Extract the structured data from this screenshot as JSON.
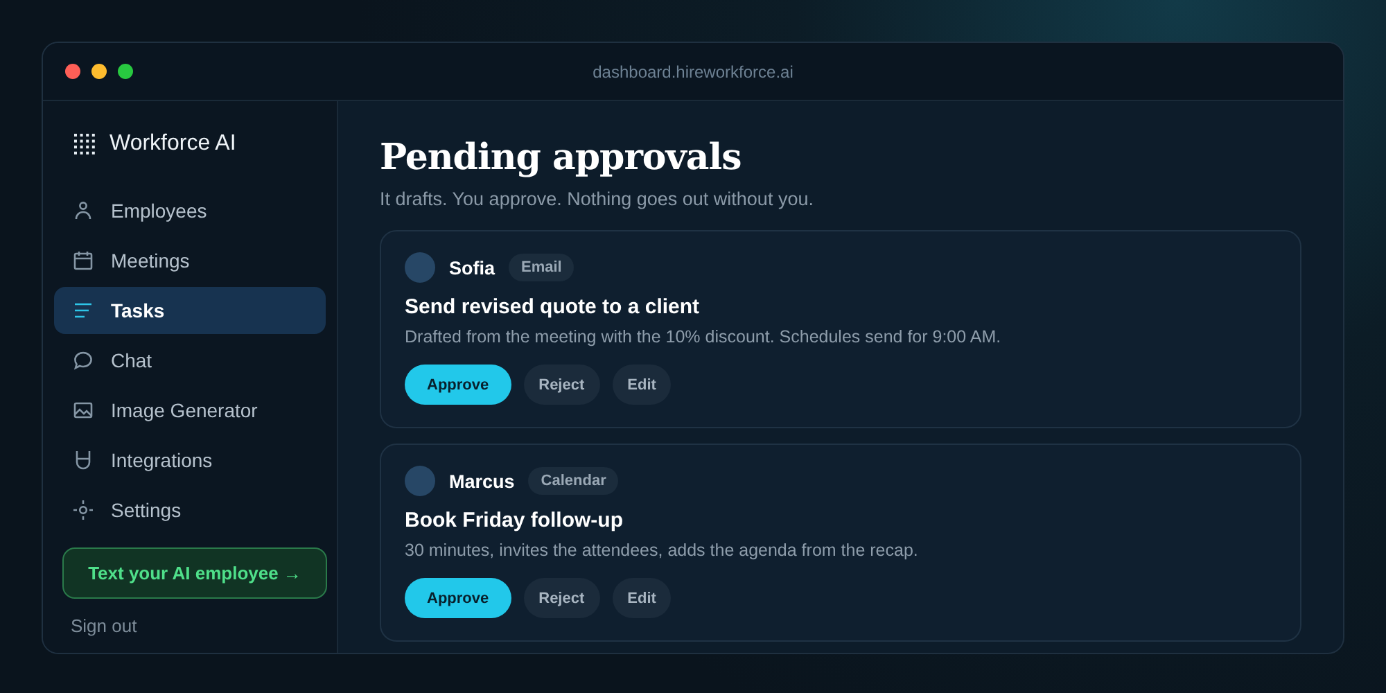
{
  "window": {
    "title": "dashboard.hireworkforce.ai"
  },
  "sidebar": {
    "brand": "Workforce AI",
    "items": [
      {
        "label": "Employees",
        "selected": false
      },
      {
        "label": "Meetings",
        "selected": false
      },
      {
        "label": "Tasks",
        "selected": true
      },
      {
        "label": "Chat",
        "selected": false
      },
      {
        "label": "Image Generator",
        "selected": false
      },
      {
        "label": "Integrations",
        "selected": false
      },
      {
        "label": "Settings",
        "selected": false
      }
    ],
    "cta": "Text your AI employee →",
    "sign_out": "Sign out"
  },
  "main": {
    "title": "Pending approvals",
    "subtitle": "It drafts. You approve. Nothing goes out without you.",
    "approvals": [
      {
        "employee": "Sofia",
        "channel": "Email",
        "title": "Send revised quote to a client",
        "detail": "Drafted from the meeting with the 10% discount. Schedules send for 9:00 AM.",
        "actions": [
          "Approve",
          "Reject",
          "Edit"
        ]
      },
      {
        "employee": "Marcus",
        "channel": "Calendar",
        "title": "Book Friday follow-up",
        "detail": "30 minutes, invites the attendees, adds the agenda from the recap.",
        "actions": [
          "Approve",
          "Reject",
          "Edit"
        ]
      }
    ]
  }
}
